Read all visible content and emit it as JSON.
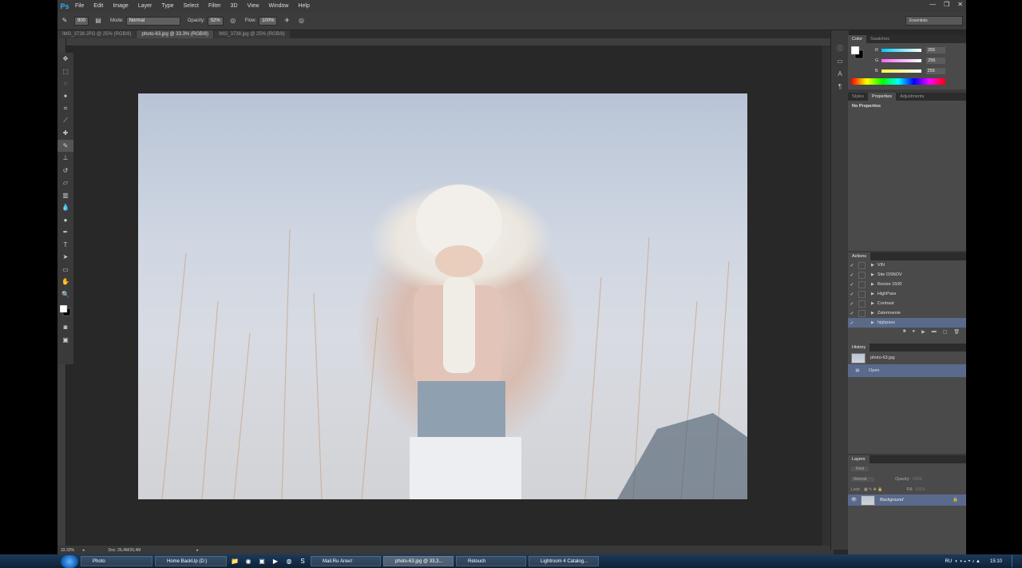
{
  "app": {
    "logo": "Ps",
    "menu": [
      "File",
      "Edit",
      "Image",
      "Layer",
      "Type",
      "Select",
      "Filter",
      "3D",
      "View",
      "Window",
      "Help"
    ],
    "window_controls": [
      "—",
      "❐",
      "✕"
    ]
  },
  "options_bar": {
    "brush_size": "900",
    "mode_label": "Mode:",
    "mode_value": "Normal",
    "opacity_label": "Opacity:",
    "opacity_value": "52%",
    "flow_label": "Flow:",
    "flow_value": "100%",
    "workspace": "Essentials"
  },
  "tabs": [
    {
      "label": "IMG_3738.JPG @ 25% (RGB/8)"
    },
    {
      "label": "photo-63.jpg @ 33.3% (RGB/8)"
    },
    {
      "label": "IMG_3738.jpg @ 25% (RGB/8)"
    }
  ],
  "tools": [
    "move-icon",
    "marquee-icon",
    "lasso-icon",
    "quick-select-icon",
    "crop-icon",
    "eyedropper-icon",
    "healing-icon",
    "brush-icon",
    "clone-stamp-icon",
    "history-brush-icon",
    "eraser-icon",
    "gradient-icon",
    "blur-icon",
    "dodge-icon",
    "pen-icon",
    "type-icon",
    "path-select-icon",
    "shape-icon",
    "hand-icon",
    "zoom-icon"
  ],
  "status": {
    "zoom": "33.33%",
    "doc": "Doc: 26,4M/26,4M"
  },
  "color_panel": {
    "tabs": [
      "Color",
      "Swatches"
    ],
    "channels": [
      {
        "name": "R",
        "value": "255",
        "gradient": "#00c8ff"
      },
      {
        "name": "G",
        "value": "255",
        "gradient": "#ff60ff"
      },
      {
        "name": "B",
        "value": "255",
        "gradient": "#ffff40"
      }
    ]
  },
  "properties_panel": {
    "tabs": [
      "Styles",
      "Properties",
      "Adjustments"
    ],
    "content": "No Properties"
  },
  "actions_panel": {
    "title": "Actions",
    "items": [
      {
        "label": "VIN",
        "selected": false
      },
      {
        "label": "Site OSNOV",
        "selected": false
      },
      {
        "label": "Resize 1500",
        "selected": false
      },
      {
        "label": "HighPass",
        "selected": false
      },
      {
        "label": "Contrast",
        "selected": false
      },
      {
        "label": "Zatemnenie",
        "selected": false
      },
      {
        "label": "highpass",
        "selected": true
      }
    ]
  },
  "history_panel": {
    "title": "History",
    "items": [
      {
        "label": "photo-63.jpg",
        "selected": false
      },
      {
        "label": "Open",
        "selected": true
      }
    ]
  },
  "layers_panel": {
    "title": "Layers",
    "kind": "Kind",
    "blend": "Normal",
    "opacity_label": "Opacity:",
    "opacity_value": "100%",
    "lock_label": "Lock:",
    "fill_label": "Fill:",
    "fill_value": "100%",
    "layers": [
      {
        "name": "Background"
      }
    ]
  },
  "taskbar": {
    "tasks": [
      {
        "label": "Photo",
        "active": false
      },
      {
        "label": "Home BackUp (D:)",
        "active": false
      },
      {
        "label": "Mail.Ru Агент",
        "active": false
      },
      {
        "label": "photo-63.jpg @ 33,3...",
        "active": true
      },
      {
        "label": "Retouch",
        "active": false
      },
      {
        "label": "Lightroom 4 Catalog...",
        "active": false
      }
    ],
    "language": "RU",
    "clock": "15:10"
  }
}
